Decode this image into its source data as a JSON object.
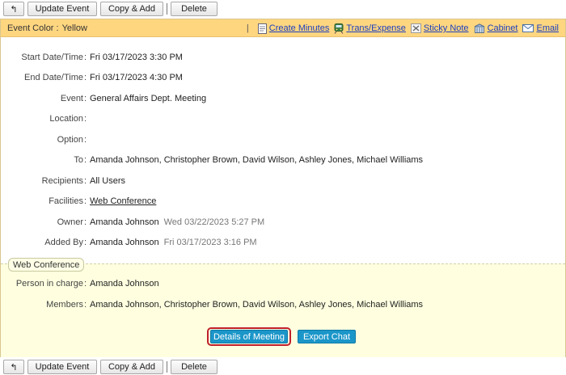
{
  "toolbar": {
    "back_glyph": "↰",
    "update_label": "Update Event",
    "copy_label": "Copy & Add",
    "delete_label": "Delete"
  },
  "colorbar": {
    "label": "Event Color :",
    "value": "Yellow",
    "separator": "|",
    "links": {
      "create_minutes": "Create Minutes",
      "trans_expense": "Trans/Expense",
      "sticky_note": "Sticky Note",
      "cabinet": "Cabinet",
      "email": "Email"
    }
  },
  "colon": ":",
  "fields": {
    "start": {
      "label": "Start Date/Time",
      "value": "Fri 03/17/2023 3:30 PM"
    },
    "end": {
      "label": "End Date/Time",
      "value": "Fri 03/17/2023 4:30 PM"
    },
    "event": {
      "label": "Event",
      "value": "General Affairs Dept. Meeting"
    },
    "location": {
      "label": "Location",
      "value": ""
    },
    "option": {
      "label": "Option",
      "value": ""
    },
    "to": {
      "label": "To",
      "value": "Amanda Johnson, Christopher Brown, David Wilson, Ashley Jones, Michael Williams"
    },
    "recipients": {
      "label": "Recipients",
      "value": "All Users"
    },
    "facilities": {
      "label": "Facilities",
      "value": "Web Conference"
    },
    "owner": {
      "label": "Owner",
      "value": "Amanda Johnson",
      "timestamp": "Wed 03/22/2023 5:27 PM"
    },
    "added_by": {
      "label": "Added By",
      "value": "Amanda Johnson",
      "timestamp": "Fri 03/17/2023 3:16 PM"
    }
  },
  "web_conference": {
    "section_label": "Web Conference",
    "person_in_charge": {
      "label": "Person in charge",
      "value": "Amanda Johnson"
    },
    "members": {
      "label": "Members",
      "value": "Amanda Johnson, Christopher Brown, David Wilson, Ashley Jones, Michael Williams"
    },
    "details_button": "Details of Meeting",
    "export_button": "Export Chat"
  },
  "colors": {
    "event_color_bar": "#ffd680",
    "section_bg": "#ffffe0",
    "action_button": "#1b96c9",
    "focus_ring": "#c0202a",
    "link": "#1a3fbf"
  },
  "icons": [
    "back-arrow-icon",
    "minutes-icon",
    "train-icon",
    "sticky-note-icon",
    "cabinet-icon",
    "email-icon"
  ]
}
